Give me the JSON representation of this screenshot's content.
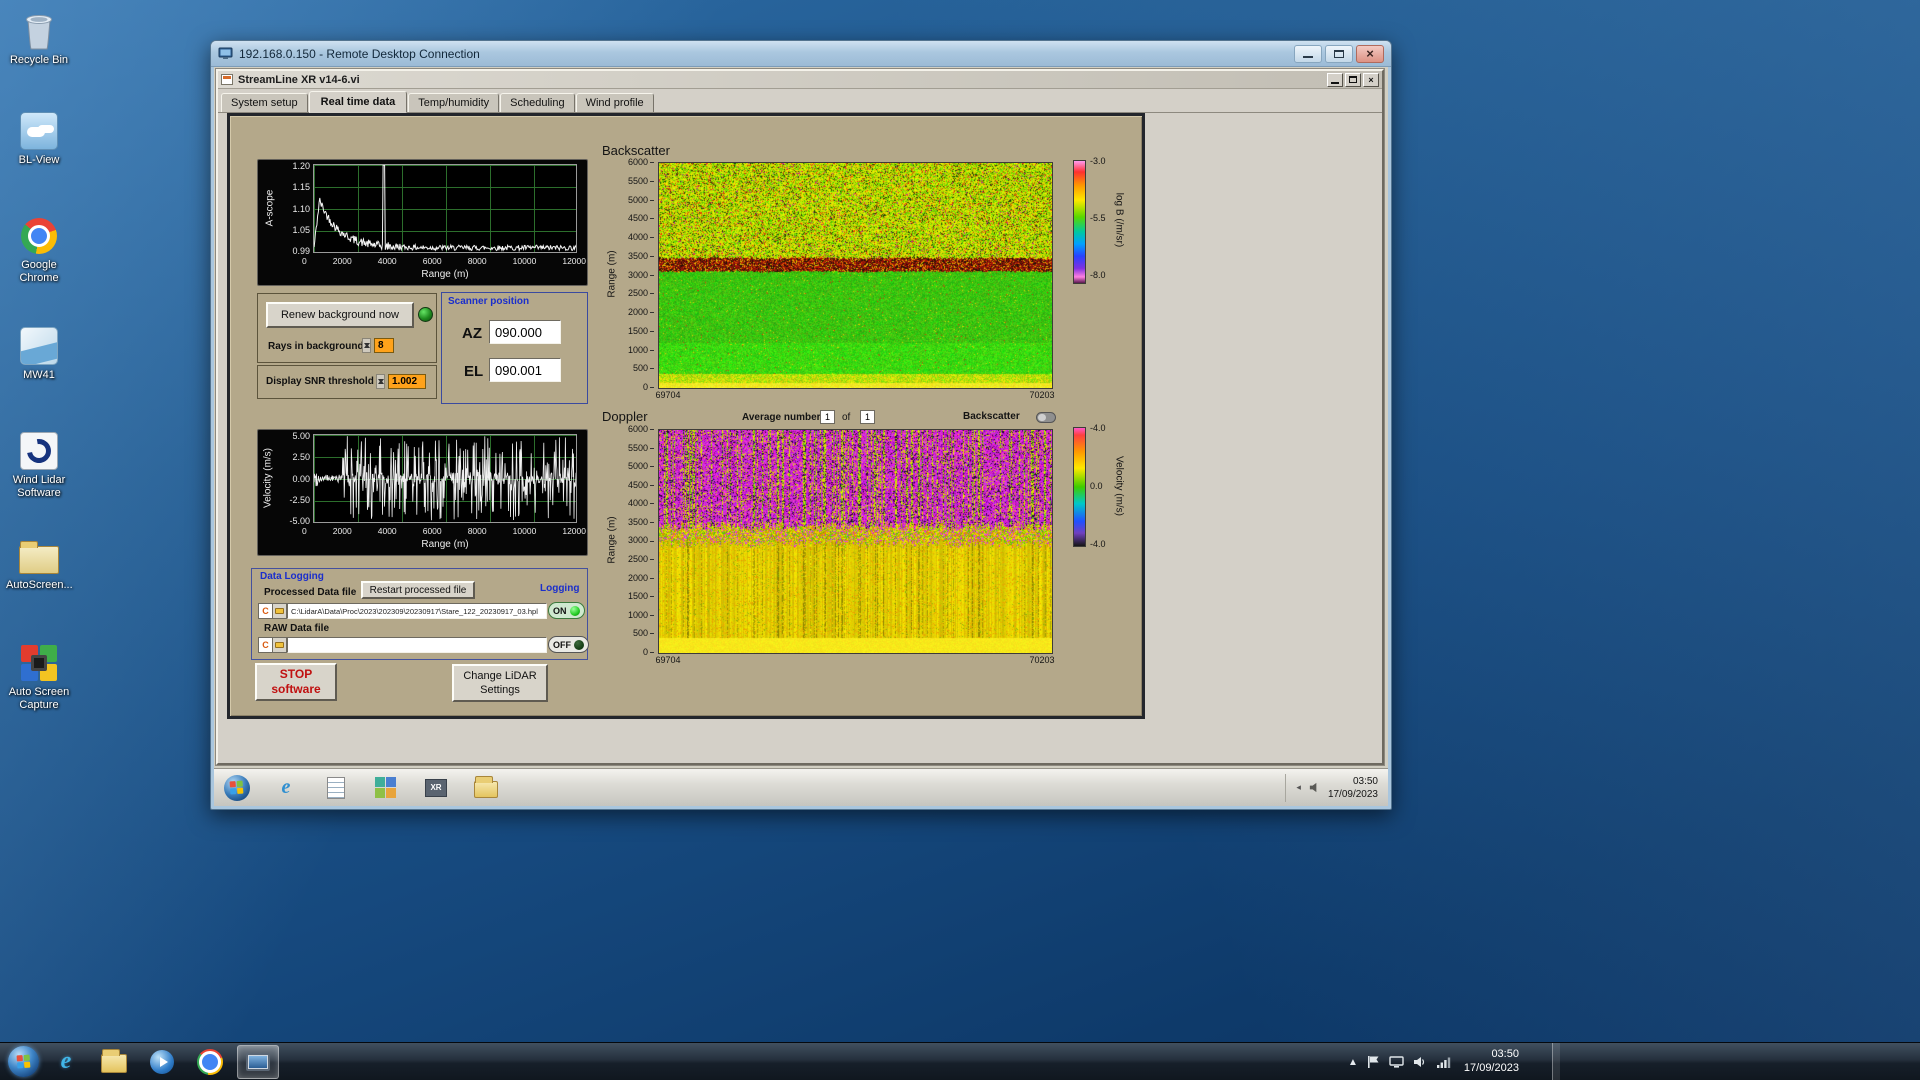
{
  "desktop": {
    "icons": [
      {
        "label": "Recycle Bin"
      },
      {
        "label": "BL-View"
      },
      {
        "label": "Google Chrome"
      },
      {
        "label": "MW41"
      },
      {
        "label": "Wind Lidar Software"
      },
      {
        "label": "AutoScreen..."
      },
      {
        "label": "Auto Screen Capture"
      }
    ]
  },
  "taskbar": {
    "clock_time": "03:50",
    "clock_date": "17/09/2023"
  },
  "rdp": {
    "title": "192.168.0.150 - Remote Desktop Connection"
  },
  "app": {
    "title": "StreamLine XR v14-6.vi",
    "tabs": [
      {
        "label": "System setup"
      },
      {
        "label": "Real time data",
        "active": true
      },
      {
        "label": "Temp/humidity"
      },
      {
        "label": "Scheduling"
      },
      {
        "label": "Wind profile"
      }
    ]
  },
  "panel": {
    "renew_button": "Renew background now",
    "rays_label": "Rays in background",
    "rays_value": "8",
    "snr_label": "Display SNR threshold",
    "snr_value": "1.002",
    "scanner": {
      "title": "Scanner position",
      "az_label": "AZ",
      "az_value": "090.000",
      "el_label": "EL",
      "el_value": "090.001"
    },
    "logging": {
      "title": "Data Logging",
      "processed_label": "Processed Data file",
      "restart_button": "Restart processed file",
      "logging_label": "Logging",
      "drive_letter": "C",
      "processed_path": "C:\\LidarA\\Data\\Proc\\2023\\202309\\20230917\\Stare_122_20230917_03.hpl",
      "on_label": "ON",
      "raw_label": "RAW Data file",
      "raw_path": "",
      "off_label": "OFF"
    },
    "stop_button_line1": "STOP",
    "stop_button_line2": "software",
    "change_button_line1": "Change LiDAR",
    "change_button_line2": "Settings",
    "doppler_header": {
      "average_label": "Average number",
      "average_value": "1",
      "of_label": "of",
      "of_value": "1",
      "backscatter_toggle_label": "Backscatter"
    }
  },
  "remote_taskbar": {
    "clock_time": "03:50",
    "clock_date": "17/09/2023"
  },
  "chart_data": [
    {
      "id": "ascope",
      "type": "line",
      "title": "A-scope",
      "xlabel": "Range (m)",
      "ylabel": "A-scope",
      "xlim": [
        0,
        12000
      ],
      "ylim": [
        0.99,
        1.2
      ],
      "xticks": [
        "0",
        "2000",
        "4000",
        "6000",
        "8000",
        "10000",
        "12000"
      ],
      "yticks": [
        "1.20",
        "1.15",
        "1.10",
        "1.05",
        "0.99"
      ],
      "grid": true,
      "series": [
        {
          "name": "A-scope",
          "description": "white noisy trace starting near 1.10, decaying to a ~1.00 baseline, with a narrow full-height spike near 3200 m",
          "baseline": 1.0,
          "start_peak": 1.115,
          "decay_range_m": 900,
          "spike_x_m": 3200,
          "spike_y": 1.2,
          "noise": 0.013
        }
      ]
    },
    {
      "id": "velocity",
      "type": "line",
      "title": "Velocity",
      "xlabel": "Range (m)",
      "ylabel": "Velocity (m/s)",
      "xlim": [
        0,
        12000
      ],
      "ylim": [
        -5,
        5
      ],
      "xticks": [
        "0",
        "2000",
        "4000",
        "6000",
        "8000",
        "10000",
        "12000"
      ],
      "yticks": [
        "5.00",
        "2.50",
        "0.00",
        "-2.50",
        "-5.00"
      ],
      "grid": true,
      "series": [
        {
          "name": "Velocity",
          "description": "low-amplitude noise near 0 m/s at short range, saturated full-scale noise spikes beyond ~1500 m",
          "quiet_range_m": 1300,
          "noise_quiet": 0.9,
          "spike_probability": 0.55
        }
      ]
    },
    {
      "id": "backscatter",
      "type": "heatmap",
      "title": "Backscatter",
      "ylabel": "Range (m)",
      "ylim": [
        0,
        6000
      ],
      "yticks": [
        "6000",
        "5500",
        "5000",
        "4500",
        "4000",
        "3500",
        "3000",
        "2500",
        "2000",
        "1500",
        "1000",
        "500",
        "0"
      ],
      "x_start": "69704",
      "x_end": "70203",
      "colorbar": {
        "ticks": [
          "-3.0",
          "-5.5",
          "-8.0"
        ],
        "label": "log B (/m/sr)"
      },
      "zones": {
        "speckle_top_m": [
          3480,
          6000
        ],
        "cloud_band_m": [
          3120,
          3480
        ],
        "clear_green_m": [
          380,
          3120
        ],
        "surface_yellow_m": [
          0,
          380
        ]
      }
    },
    {
      "id": "doppler",
      "type": "heatmap",
      "title": "Doppler",
      "ylabel": "Range (m)",
      "ylim": [
        0,
        6000
      ],
      "yticks": [
        "6000",
        "5500",
        "5000",
        "4500",
        "4000",
        "3500",
        "3000",
        "2500",
        "2000",
        "1500",
        "1000",
        "500",
        "0"
      ],
      "x_start": "69704",
      "x_end": "70203",
      "colorbar": {
        "ticks": [
          "-4.0",
          "0.0",
          "-4.0"
        ],
        "label": "Velocity (m/s)"
      },
      "zones": {
        "magenta_noise_m": [
          3420,
          6000
        ],
        "mixed_m": [
          2950,
          3420
        ],
        "yellow_m": [
          0,
          2950
        ]
      }
    }
  ]
}
